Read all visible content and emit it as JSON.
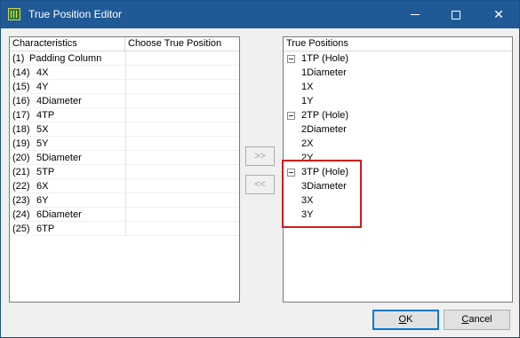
{
  "window": {
    "title": "True Position Editor"
  },
  "left_table": {
    "headers": [
      "Characteristics",
      "Choose True Position"
    ],
    "rows": [
      {
        "num": "(1)",
        "name": "Padding Column"
      },
      {
        "num": "(14)",
        "name": "4X"
      },
      {
        "num": "(15)",
        "name": "4Y"
      },
      {
        "num": "(16)",
        "name": "4Diameter"
      },
      {
        "num": "(17)",
        "name": "4TP"
      },
      {
        "num": "(18)",
        "name": "5X"
      },
      {
        "num": "(19)",
        "name": "5Y"
      },
      {
        "num": "(20)",
        "name": "5Diameter"
      },
      {
        "num": "(21)",
        "name": "5TP"
      },
      {
        "num": "(22)",
        "name": "6X"
      },
      {
        "num": "(23)",
        "name": "6Y"
      },
      {
        "num": "(24)",
        "name": "6Diameter"
      },
      {
        "num": "(25)",
        "name": "6TP"
      }
    ]
  },
  "transfer": {
    "add_label": ">>",
    "remove_label": "<<"
  },
  "right_tree": {
    "header": "True Positions",
    "nodes": [
      {
        "label": "1TP (Hole)",
        "children": [
          "1Diameter",
          "1X",
          "1Y"
        ]
      },
      {
        "label": "2TP (Hole)",
        "children": [
          "2Diameter",
          "2X",
          "2Y"
        ]
      },
      {
        "label": "3TP (Hole)",
        "children": [
          "3Diameter",
          "3X",
          "3Y"
        ]
      }
    ]
  },
  "buttons": {
    "ok_first": "O",
    "ok_rest": "K",
    "cancel_first": "C",
    "cancel_rest": "ancel"
  },
  "colors": {
    "titlebar": "#1f5a96",
    "highlight": "#d41a1a",
    "default_button_border": "#0078d7"
  }
}
